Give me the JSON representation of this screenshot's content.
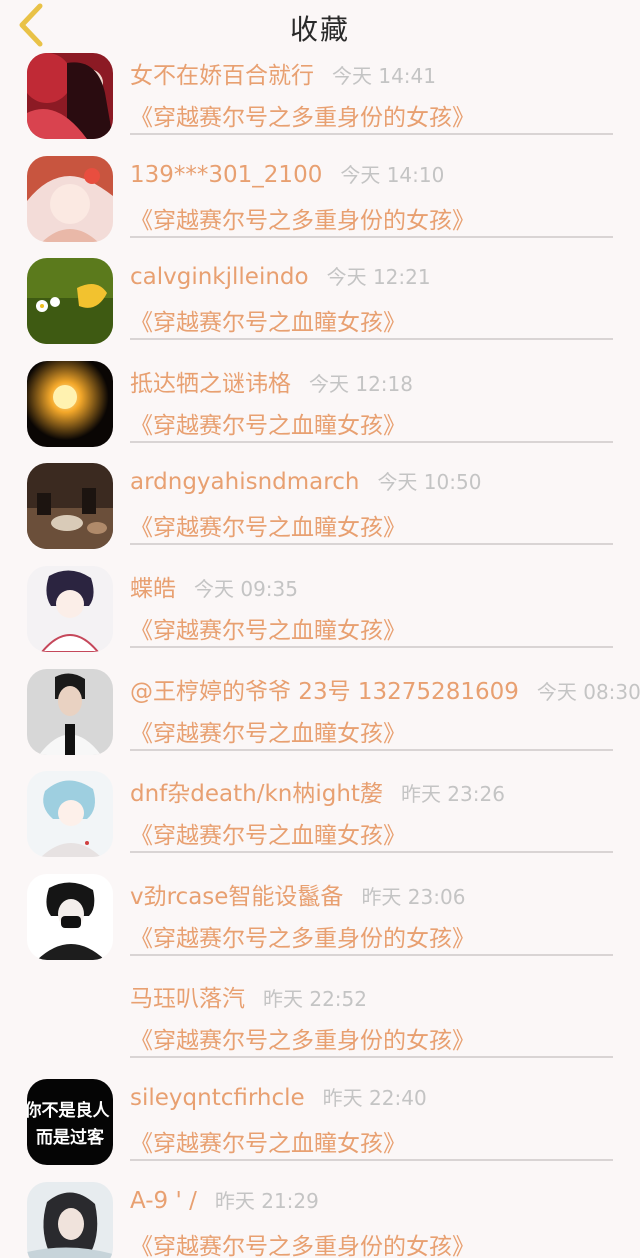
{
  "header": {
    "title": "收藏",
    "back_icon": "chevron-left-icon",
    "back_color": "#e9c247"
  },
  "colors": {
    "accent": "#e8a071",
    "time": "#c4c4c4",
    "divider": "#d9d4d4"
  },
  "items": [
    {
      "name": "女不在娇百合就行",
      "time": "今天 14:41",
      "novel": "《穿越赛尔号之多重身份的女孩》"
    },
    {
      "name": "139***301_2100",
      "time": "今天 14:10",
      "novel": "《穿越赛尔号之多重身份的女孩》"
    },
    {
      "name": "calvginkjlleindo",
      "time": "今天 12:21",
      "novel": "《穿越赛尔号之血瞳女孩》"
    },
    {
      "name": "抵达牺之谜讳格",
      "time": "今天 12:18",
      "novel": "《穿越赛尔号之血瞳女孩》"
    },
    {
      "name": "ardngyahisndmarch",
      "time": "今天 10:50",
      "novel": "《穿越赛尔号之血瞳女孩》"
    },
    {
      "name": "蝶皓",
      "time": "今天 09:35",
      "novel": "《穿越赛尔号之血瞳女孩》"
    },
    {
      "name": "@王梈婷的爷爷 23号 13275281609",
      "time": "今天 08:30",
      "novel": "《穿越赛尔号之血瞳女孩》"
    },
    {
      "name": "dnf杂death/kn枘ight嫠",
      "time": "昨天 23:26",
      "novel": "《穿越赛尔号之血瞳女孩》"
    },
    {
      "name": "v劲rcase智能设鬣备",
      "time": "昨天 23:06",
      "novel": "《穿越赛尔号之多重身份的女孩》"
    },
    {
      "name": "马珏叭落汽",
      "time": "昨天 22:52",
      "novel": "《穿越赛尔号之多重身份的女孩》"
    },
    {
      "name": "sileyqntcfirhcle",
      "time": "昨天 22:40",
      "novel": "《穿越赛尔号之血瞳女孩》",
      "avatar_text": [
        "你不是良人",
        "而是过客"
      ]
    },
    {
      "name": "A-9 ' /",
      "time": "昨天 21:29",
      "novel": "《穿越赛尔号之多重身份的女孩》"
    }
  ]
}
